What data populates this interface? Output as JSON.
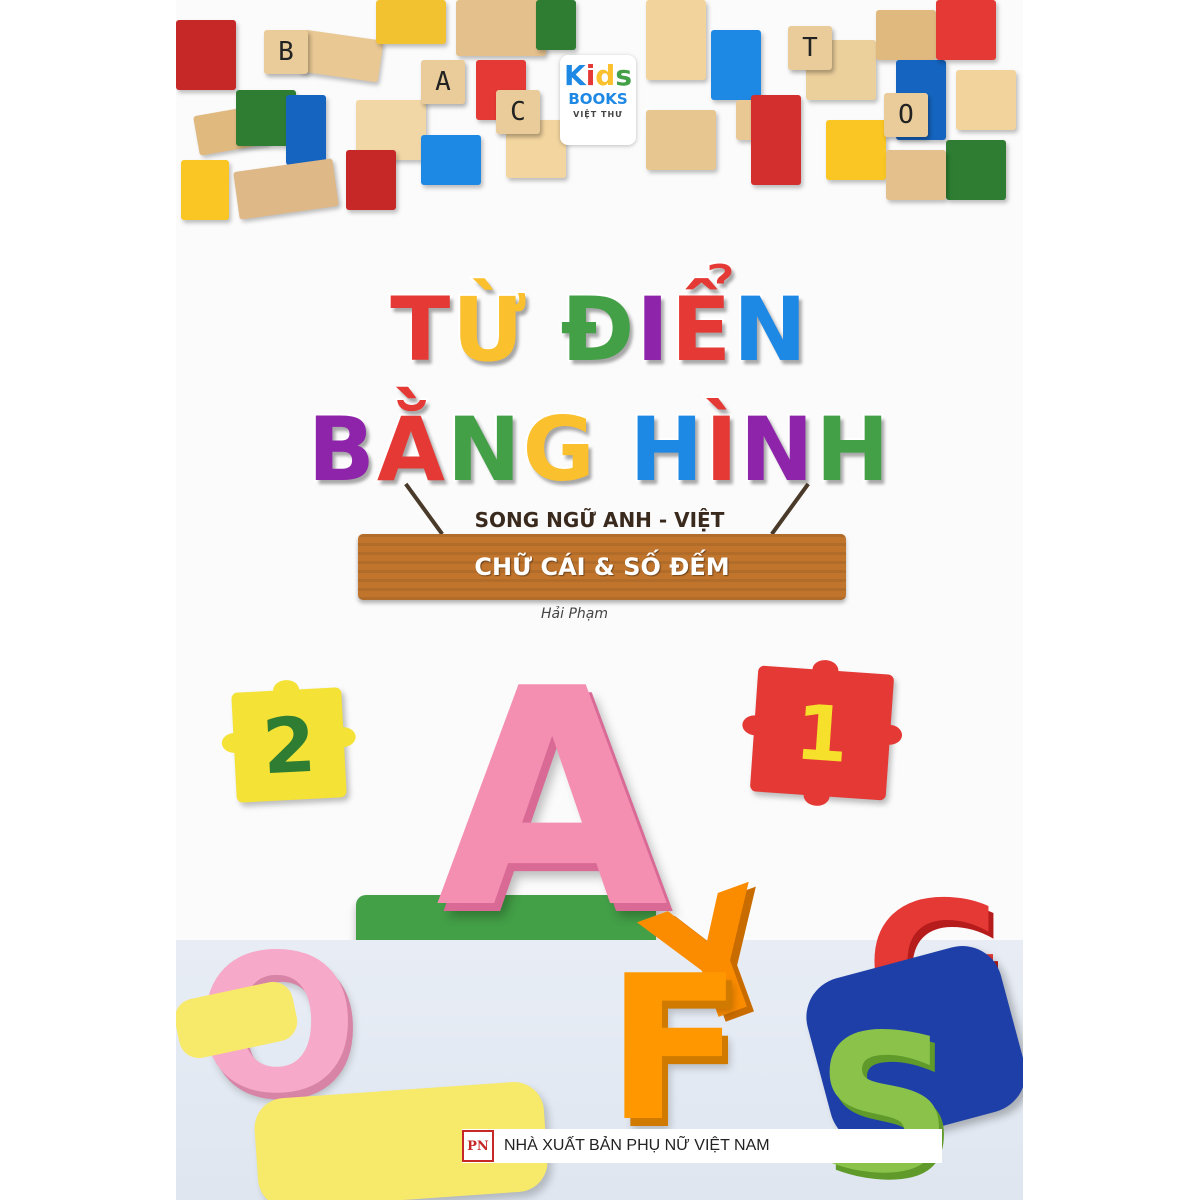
{
  "logo": {
    "kids": "Kids",
    "books": "BOOKS",
    "tag": "VIỆT THƯ"
  },
  "blocks_letters": [
    "B",
    "A",
    "C",
    "T",
    "O"
  ],
  "title": {
    "line1": "TỪ ĐIỂN",
    "line2": "BẰNG HÌNH"
  },
  "subtitle": "SONG NGỮ ANH - VIỆT",
  "sign_label": "CHỮ CÁI & SỐ ĐẾM",
  "author": "Hải Phạm",
  "puzzles": {
    "left_number": "2",
    "right_number": "1"
  },
  "featured_letters": {
    "big": "A",
    "bottom_left": "O",
    "middle": "F",
    "middle2": "Y",
    "bottom_right": "S",
    "right": "G"
  },
  "publisher": {
    "logo_text": "PN",
    "name": "NHÀ XUẤT BẢN PHỤ NỮ VIỆT NAM"
  },
  "colors": {
    "title1": [
      "#e53935",
      "#fbc02d",
      "#43a047",
      "#8e24aa",
      "#e53935",
      "#1e88e5",
      "#fbc02d"
    ],
    "title2": [
      "#8e24aa",
      "#e53935",
      "#43a047",
      "#fbc02d",
      "#1e88e5",
      "#e53935",
      "#8e24aa",
      "#43a047",
      "#1e88e5"
    ],
    "puzzle_left": "#f4e237",
    "puzzle_left_text": "#2e7d32",
    "puzzle_right": "#e53935",
    "puzzle_right_text": "#f7e02b",
    "kids_logo": [
      "#1e88e5",
      "#e53935",
      "#fbc02d",
      "#43a047"
    ]
  }
}
